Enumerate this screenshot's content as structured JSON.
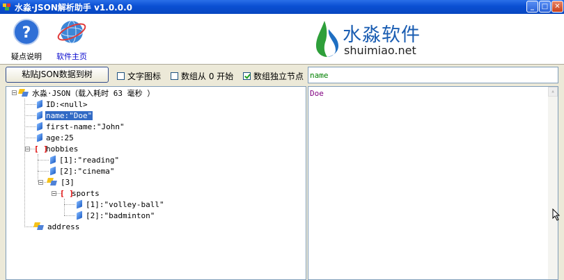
{
  "window": {
    "title": "水淼·JSON解析助手 v1.0.0.0"
  },
  "toolbar": {
    "help_label": "疑点说明",
    "home_label": "软件主页"
  },
  "logo": {
    "name_cn": "水淼软件",
    "url_text": "shuimiao.net"
  },
  "controls": {
    "paste_button": "粘贴JSON数据到树",
    "text_icon_label": "文字图标",
    "text_icon_checked": false,
    "array_from_zero_label": "数组从 0 开始",
    "array_from_zero_checked": false,
    "array_node_label": "数组独立节点",
    "array_node_checked": true
  },
  "selected_name": "name",
  "selected_value": "Doe",
  "tree": {
    "root": "水淼·JSON（载入耗时 63 毫秒 ）",
    "id": "ID:<null>",
    "name": "name:\"Doe\"",
    "first_name": "first-name:\"John\"",
    "age": "age:25",
    "hobbies": "hobbies",
    "h1": "[1]:\"reading\"",
    "h2": "[2]:\"cinema\"",
    "h3": "[3]",
    "sports": "sports",
    "s1": "[1]:\"volley-ball\"",
    "s2": "[2]:\"badminton\"",
    "address": "address"
  }
}
